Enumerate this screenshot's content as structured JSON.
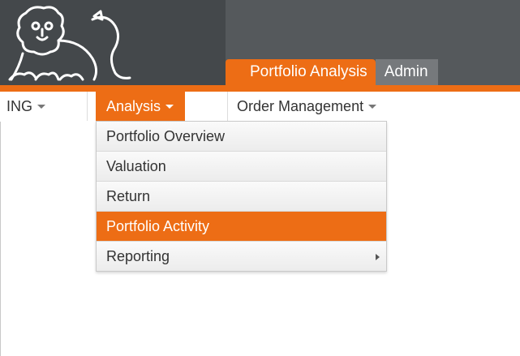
{
  "header": {
    "tabs": [
      {
        "label": "Portfolio Analysis",
        "active": true
      },
      {
        "label": "Admin",
        "active": false
      }
    ]
  },
  "menubar": {
    "items": [
      {
        "label": "ING",
        "active": false
      },
      {
        "label": "Analysis",
        "active": true
      },
      {
        "label": "Order Management",
        "active": false
      }
    ]
  },
  "dropdown": {
    "items": [
      {
        "label": "Portfolio Overview",
        "active": false,
        "submenu": false
      },
      {
        "label": "Valuation",
        "active": false,
        "submenu": false
      },
      {
        "label": "Return",
        "active": false,
        "submenu": false
      },
      {
        "label": "Portfolio Activity",
        "active": true,
        "submenu": false
      },
      {
        "label": "Reporting",
        "active": false,
        "submenu": true
      }
    ]
  },
  "colors": {
    "accent": "#ed6d15",
    "header_bg": "#55595c",
    "logo_bg": "#44484b",
    "inactive_tab": "#76797c"
  },
  "icons": {
    "logo": "ing-lion-logo-icon",
    "caret": "caret-down-icon",
    "submenu": "chevron-right-icon"
  }
}
